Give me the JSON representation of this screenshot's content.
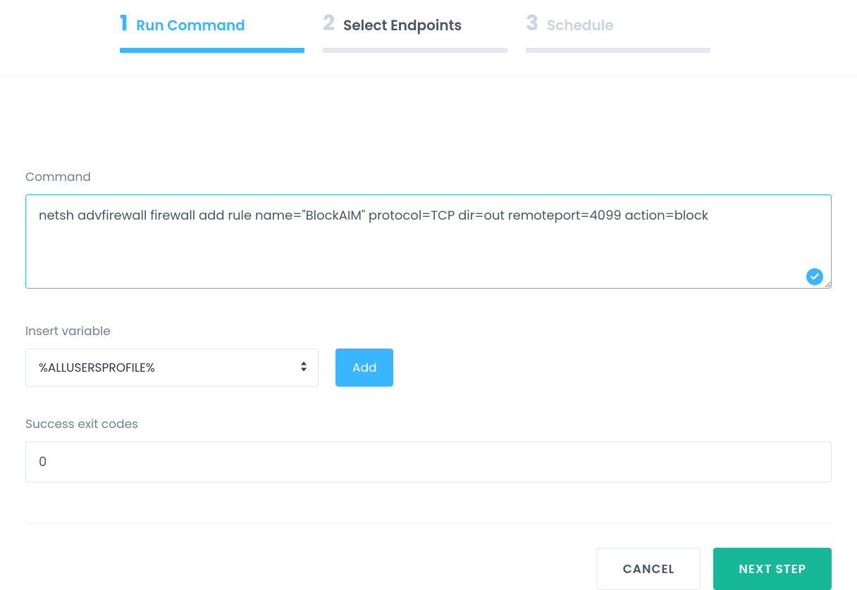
{
  "steps": [
    {
      "num": "1",
      "label": "Run Command",
      "state": "active"
    },
    {
      "num": "2",
      "label": "Select Endpoints",
      "state": "normal"
    },
    {
      "num": "3",
      "label": "Schedule",
      "state": "disabled"
    }
  ],
  "form": {
    "command_label": "Command",
    "command_value": "netsh advfirewall firewall add rule name=\"BlockAIM\" protocol=TCP dir=out remoteport=4099 action=block",
    "insert_variable_label": "Insert variable",
    "variable_selected": "%ALLUSERSPROFILE%",
    "add_button": "Add",
    "exit_codes_label": "Success exit codes",
    "exit_codes_value": "0"
  },
  "footer": {
    "cancel": "CANCEL",
    "next": "NEXT STEP"
  },
  "colors": {
    "accent": "#38b6ff",
    "success": "#17b897"
  }
}
